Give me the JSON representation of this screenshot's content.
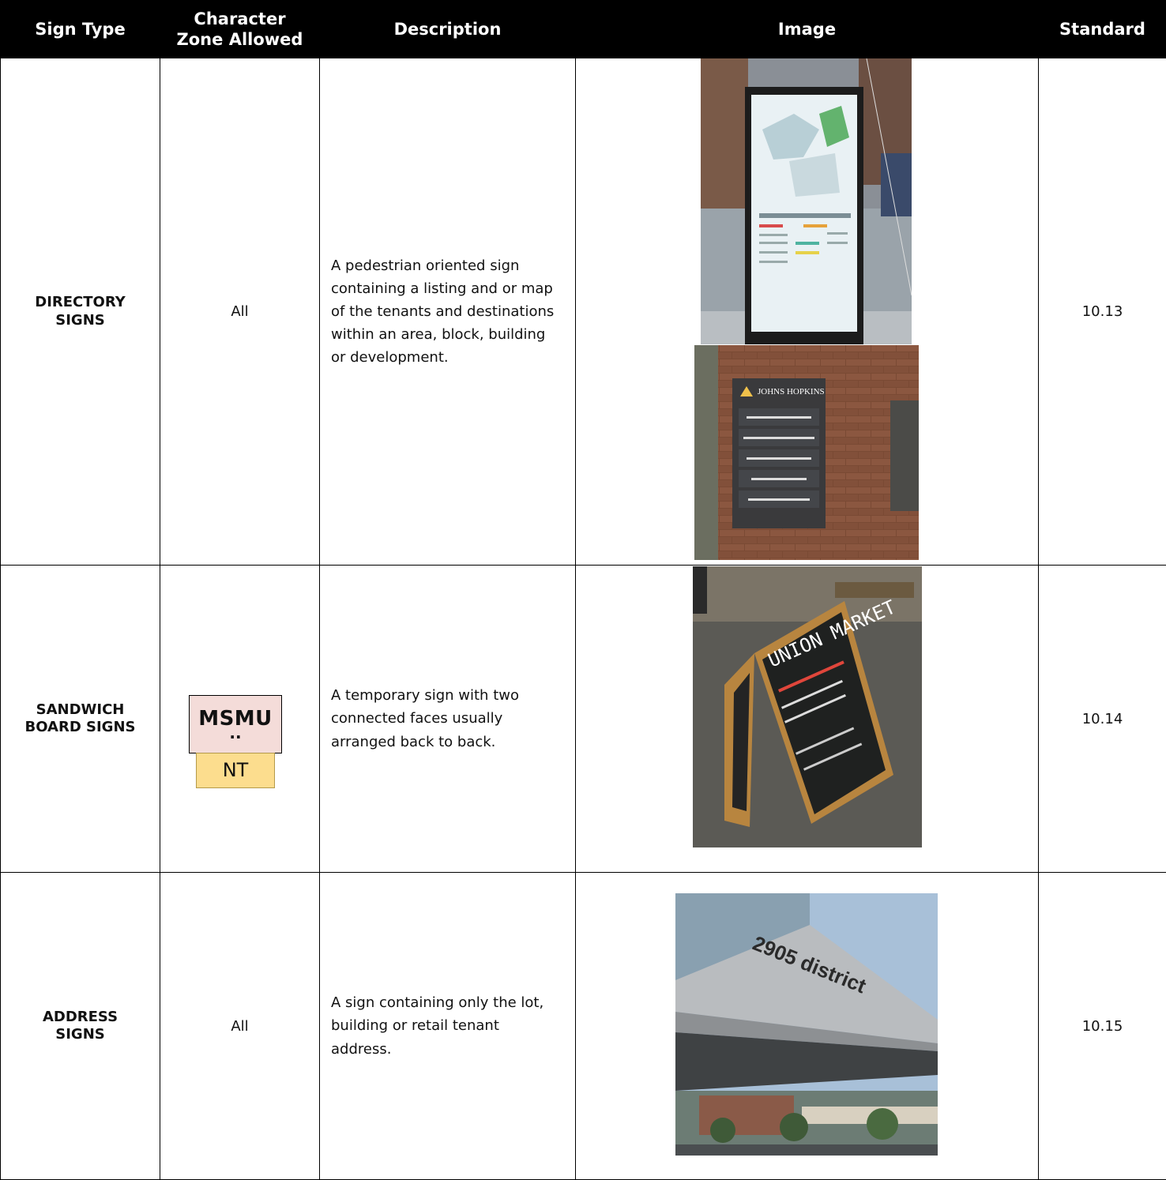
{
  "headers": [
    "Sign Type",
    "Character Zone Allowed",
    "Description",
    "Image",
    "Standard"
  ],
  "rows": [
    {
      "type": "DIRECTORY SIGNS",
      "zone": "All",
      "description": "A pedestrian oriented sign containing a listing and or map of the tenants and destinations within an area, block, building or development.",
      "standard": "10.13",
      "images": [
        {
          "subject": "map-kiosk",
          "text": ""
        },
        {
          "subject": "wall-directory",
          "text": "JOHNS HOPKINS"
        }
      ]
    },
    {
      "type": "SANDWICH BOARD SIGNS",
      "zone_badge": {
        "top": "MSMU",
        "dots": "..",
        "bottom": "NT"
      },
      "description": "A temporary sign with two connected faces usually arranged back to back.",
      "standard": "10.14",
      "images": [
        {
          "subject": "chalkboard-easel",
          "text": "UNION MARKET"
        }
      ]
    },
    {
      "type": "ADDRESS SIGNS",
      "zone": "All",
      "description": "A sign containing only the lot, building or retail tenant address.",
      "standard": "10.15",
      "images": [
        {
          "subject": "canopy-address",
          "text": "2905 district"
        }
      ]
    }
  ],
  "colors": {
    "header_bg": "#000000",
    "header_text": "#ffffff",
    "badge_top": "#f4dcd9",
    "badge_bottom": "#fcdd8e"
  }
}
